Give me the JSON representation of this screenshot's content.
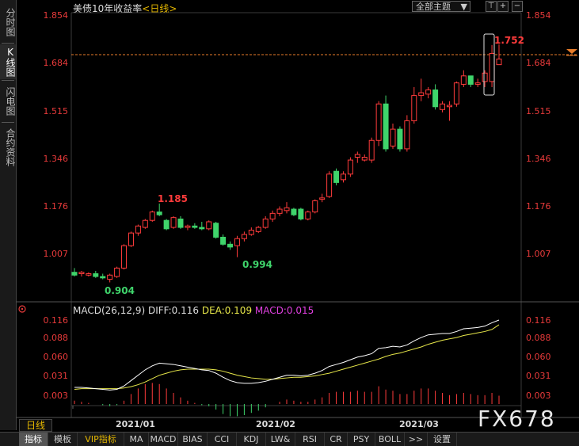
{
  "left_tabs": [
    {
      "label": "分时图",
      "active": false
    },
    {
      "label": "K线图",
      "active": true
    },
    {
      "label": "闪电图",
      "active": false
    },
    {
      "label": "合约资料",
      "active": false
    }
  ],
  "header": {
    "title": "美债10年收益率",
    "period_tag": "<日线>",
    "theme_button": "全部主题",
    "theme_arrow": "▼"
  },
  "price_axis": {
    "labels": [
      "1.854",
      "1.684",
      "1.515",
      "1.346",
      "1.176",
      "1.007"
    ],
    "current_price_marker": "1.684"
  },
  "annotations": {
    "high": "1.752",
    "peak_jan": "1.185",
    "low_start": "0.904",
    "low_feb": "0.994"
  },
  "macd": {
    "title": "MACD(26,12,9)",
    "diff": "DIFF:0.116",
    "dea": "DEA:0.109",
    "macd": "MACD:0.015",
    "axis_labels": [
      "0.116",
      "0.088",
      "0.060",
      "0.031",
      "0.003"
    ],
    "colors": {
      "diff": "#ffffff",
      "dea": "#e8e84a",
      "macd": "#e040e0"
    }
  },
  "date_axis": [
    "2021/01",
    "2021/02",
    "2021/03"
  ],
  "period_label": "日线",
  "bottom_tabs": [
    "指标",
    "模板",
    "VIP指标",
    "MA",
    "MACD",
    "BIAS",
    "CCI",
    "KDJ",
    "LW&",
    "RSI",
    "CR",
    "PSY",
    "BOLL",
    ">>",
    "设置"
  ],
  "watermark": "FX678",
  "chart_data": {
    "type": "candlestick",
    "y_range": [
      0.9,
      1.854
    ],
    "candles": [
      {
        "o": 0.94,
        "h": 0.955,
        "l": 0.925,
        "c": 0.93
      },
      {
        "o": 0.935,
        "h": 0.945,
        "l": 0.925,
        "c": 0.94
      },
      {
        "o": 0.93,
        "h": 0.94,
        "l": 0.925,
        "c": 0.935
      },
      {
        "o": 0.935,
        "h": 0.945,
        "l": 0.92,
        "c": 0.925
      },
      {
        "o": 0.925,
        "h": 0.935,
        "l": 0.915,
        "c": 0.92
      },
      {
        "o": 0.915,
        "h": 0.935,
        "l": 0.904,
        "c": 0.93
      },
      {
        "o": 0.925,
        "h": 0.96,
        "l": 0.92,
        "c": 0.955
      },
      {
        "o": 0.955,
        "h": 1.04,
        "l": 0.95,
        "c": 1.035
      },
      {
        "o": 1.035,
        "h": 1.085,
        "l": 1.03,
        "c": 1.08
      },
      {
        "o": 1.08,
        "h": 1.11,
        "l": 1.07,
        "c": 1.105
      },
      {
        "o": 1.1,
        "h": 1.13,
        "l": 1.095,
        "c": 1.125
      },
      {
        "o": 1.125,
        "h": 1.16,
        "l": 1.12,
        "c": 1.155
      },
      {
        "o": 1.155,
        "h": 1.185,
        "l": 1.14,
        "c": 1.145
      },
      {
        "o": 1.125,
        "h": 1.13,
        "l": 1.09,
        "c": 1.095
      },
      {
        "o": 1.1,
        "h": 1.14,
        "l": 1.095,
        "c": 1.135
      },
      {
        "o": 1.13,
        "h": 1.14,
        "l": 1.095,
        "c": 1.1
      },
      {
        "o": 1.1,
        "h": 1.11,
        "l": 1.09,
        "c": 1.105
      },
      {
        "o": 1.105,
        "h": 1.115,
        "l": 1.095,
        "c": 1.1
      },
      {
        "o": 1.1,
        "h": 1.12,
        "l": 1.09,
        "c": 1.095
      },
      {
        "o": 1.095,
        "h": 1.125,
        "l": 1.09,
        "c": 1.12
      },
      {
        "o": 1.115,
        "h": 1.12,
        "l": 1.06,
        "c": 1.065
      },
      {
        "o": 1.065,
        "h": 1.075,
        "l": 1.035,
        "c": 1.04
      },
      {
        "o": 1.04,
        "h": 1.05,
        "l": 1.02,
        "c": 1.03
      },
      {
        "o": 1.035,
        "h": 1.07,
        "l": 0.994,
        "c": 1.06
      },
      {
        "o": 1.06,
        "h": 1.085,
        "l": 1.05,
        "c": 1.075
      },
      {
        "o": 1.075,
        "h": 1.1,
        "l": 1.07,
        "c": 1.09
      },
      {
        "o": 1.085,
        "h": 1.105,
        "l": 1.08,
        "c": 1.1
      },
      {
        "o": 1.1,
        "h": 1.14,
        "l": 1.095,
        "c": 1.13
      },
      {
        "o": 1.13,
        "h": 1.16,
        "l": 1.12,
        "c": 1.15
      },
      {
        "o": 1.15,
        "h": 1.175,
        "l": 1.14,
        "c": 1.165
      },
      {
        "o": 1.16,
        "h": 1.19,
        "l": 1.15,
        "c": 1.17
      },
      {
        "o": 1.165,
        "h": 1.17,
        "l": 1.14,
        "c": 1.145
      },
      {
        "o": 1.165,
        "h": 1.17,
        "l": 1.125,
        "c": 1.13
      },
      {
        "o": 1.13,
        "h": 1.16,
        "l": 1.125,
        "c": 1.155
      },
      {
        "o": 1.155,
        "h": 1.2,
        "l": 1.15,
        "c": 1.195
      },
      {
        "o": 1.2,
        "h": 1.22,
        "l": 1.19,
        "c": 1.205
      },
      {
        "o": 1.21,
        "h": 1.3,
        "l": 1.205,
        "c": 1.29
      },
      {
        "o": 1.3,
        "h": 1.31,
        "l": 1.25,
        "c": 1.26
      },
      {
        "o": 1.27,
        "h": 1.3,
        "l": 1.26,
        "c": 1.29
      },
      {
        "o": 1.29,
        "h": 1.35,
        "l": 1.28,
        "c": 1.34
      },
      {
        "o": 1.35,
        "h": 1.37,
        "l": 1.33,
        "c": 1.36
      },
      {
        "o": 1.34,
        "h": 1.36,
        "l": 1.335,
        "c": 1.35
      },
      {
        "o": 1.34,
        "h": 1.42,
        "l": 1.33,
        "c": 1.41
      },
      {
        "o": 1.41,
        "h": 1.55,
        "l": 1.39,
        "c": 1.54
      },
      {
        "o": 1.54,
        "h": 1.57,
        "l": 1.37,
        "c": 1.38
      },
      {
        "o": 1.39,
        "h": 1.47,
        "l": 1.38,
        "c": 1.45
      },
      {
        "o": 1.45,
        "h": 1.46,
        "l": 1.37,
        "c": 1.38
      },
      {
        "o": 1.38,
        "h": 1.5,
        "l": 1.37,
        "c": 1.48
      },
      {
        "o": 1.48,
        "h": 1.6,
        "l": 1.47,
        "c": 1.57
      },
      {
        "o": 1.57,
        "h": 1.63,
        "l": 1.55,
        "c": 1.58
      },
      {
        "o": 1.575,
        "h": 1.6,
        "l": 1.56,
        "c": 1.59
      },
      {
        "o": 1.59,
        "h": 1.61,
        "l": 1.52,
        "c": 1.53
      },
      {
        "o": 1.52,
        "h": 1.55,
        "l": 1.51,
        "c": 1.54
      },
      {
        "o": 1.53,
        "h": 1.55,
        "l": 1.48,
        "c": 1.535
      },
      {
        "o": 1.54,
        "h": 1.62,
        "l": 1.53,
        "c": 1.615
      },
      {
        "o": 1.61,
        "h": 1.66,
        "l": 1.6,
        "c": 1.64
      },
      {
        "o": 1.64,
        "h": 1.64,
        "l": 1.6,
        "c": 1.61
      },
      {
        "o": 1.61,
        "h": 1.63,
        "l": 1.6,
        "c": 1.615
      },
      {
        "o": 1.62,
        "h": 1.66,
        "l": 1.6,
        "c": 1.65
      },
      {
        "o": 1.62,
        "h": 1.75,
        "l": 1.6,
        "c": 1.72
      },
      {
        "o": 1.68,
        "h": 1.752,
        "l": 1.68,
        "c": 1.7
      }
    ],
    "macd_range": [
      -0.02,
      0.125
    ],
    "diff": [
      0.016,
      0.016,
      0.015,
      0.014,
      0.013,
      0.012,
      0.013,
      0.018,
      0.026,
      0.034,
      0.042,
      0.048,
      0.052,
      0.051,
      0.05,
      0.048,
      0.046,
      0.044,
      0.042,
      0.041,
      0.037,
      0.031,
      0.026,
      0.023,
      0.022,
      0.022,
      0.023,
      0.025,
      0.028,
      0.031,
      0.034,
      0.034,
      0.033,
      0.034,
      0.037,
      0.041,
      0.047,
      0.05,
      0.053,
      0.057,
      0.061,
      0.063,
      0.066,
      0.074,
      0.075,
      0.077,
      0.076,
      0.079,
      0.085,
      0.09,
      0.094,
      0.095,
      0.096,
      0.096,
      0.099,
      0.103,
      0.104,
      0.105,
      0.107,
      0.112,
      0.116
    ],
    "dea": [
      0.013,
      0.014,
      0.014,
      0.014,
      0.014,
      0.014,
      0.014,
      0.015,
      0.017,
      0.02,
      0.024,
      0.029,
      0.034,
      0.037,
      0.04,
      0.042,
      0.043,
      0.043,
      0.043,
      0.043,
      0.042,
      0.04,
      0.037,
      0.034,
      0.032,
      0.03,
      0.029,
      0.028,
      0.028,
      0.029,
      0.03,
      0.031,
      0.031,
      0.032,
      0.033,
      0.035,
      0.037,
      0.04,
      0.043,
      0.046,
      0.049,
      0.052,
      0.055,
      0.058,
      0.062,
      0.065,
      0.067,
      0.07,
      0.073,
      0.076,
      0.08,
      0.083,
      0.086,
      0.088,
      0.09,
      0.093,
      0.095,
      0.097,
      0.099,
      0.102,
      0.109
    ],
    "histogram": [
      0.006,
      0.004,
      0.002,
      0.0,
      -0.002,
      -0.004,
      -0.002,
      0.006,
      0.018,
      0.028,
      0.036,
      0.038,
      0.036,
      0.028,
      0.02,
      0.012,
      0.006,
      0.002,
      -0.002,
      -0.004,
      -0.01,
      -0.018,
      -0.022,
      -0.022,
      -0.02,
      -0.016,
      -0.012,
      -0.006,
      0.0,
      0.004,
      0.008,
      0.006,
      0.004,
      0.004,
      0.008,
      0.012,
      0.02,
      0.022,
      0.022,
      0.022,
      0.024,
      0.022,
      0.022,
      0.032,
      0.026,
      0.024,
      0.018,
      0.018,
      0.024,
      0.028,
      0.028,
      0.024,
      0.02,
      0.016,
      0.018,
      0.02,
      0.018,
      0.016,
      0.016,
      0.02,
      0.015
    ]
  }
}
